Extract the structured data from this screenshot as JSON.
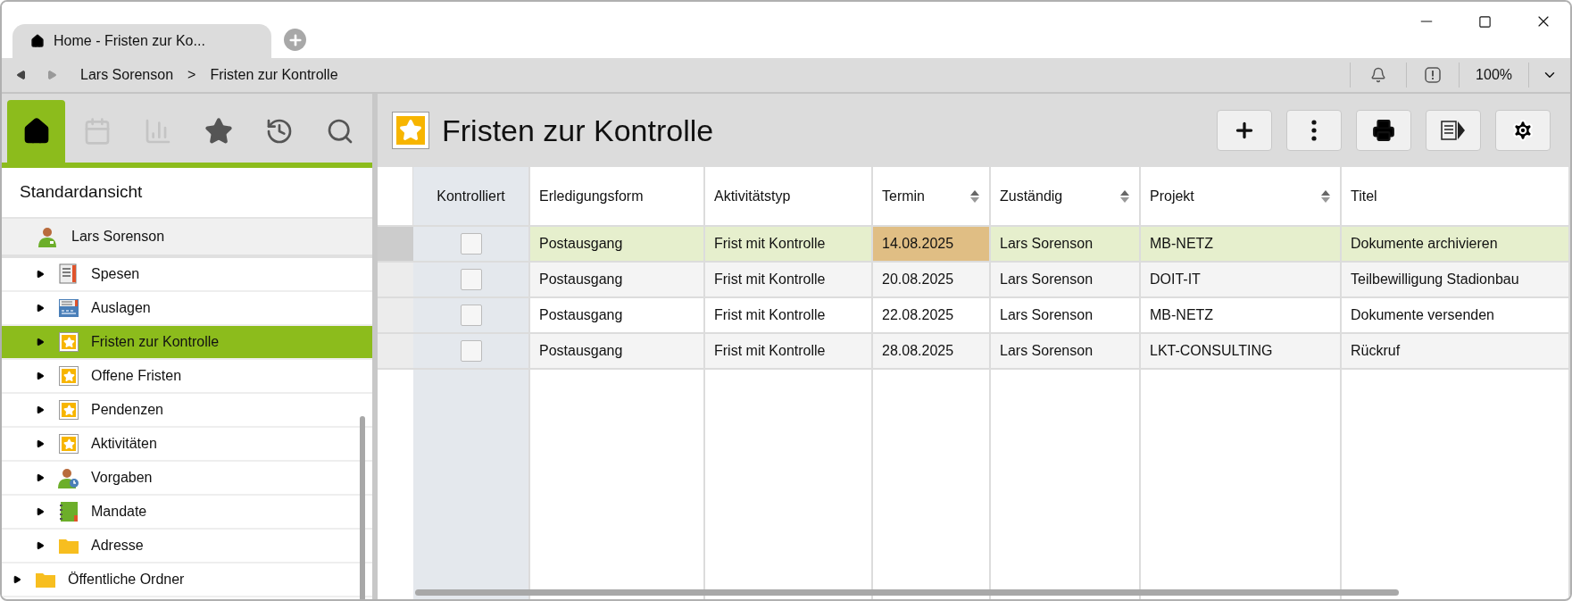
{
  "window": {
    "tab_title": "Home - Fristen zur Ko..."
  },
  "address_bar": {
    "breadcrumbs": [
      "Lars Sorenson",
      ">",
      "Fristen zur Kontrolle"
    ],
    "zoom": "100%"
  },
  "nav_tabs": [
    {
      "kind": "home",
      "selected": true,
      "disabled": false
    },
    {
      "kind": "calendar",
      "selected": false,
      "disabled": true
    },
    {
      "kind": "chart",
      "selected": false,
      "disabled": true
    },
    {
      "kind": "star",
      "selected": false,
      "disabled": false
    },
    {
      "kind": "history",
      "selected": false,
      "disabled": false
    },
    {
      "kind": "search",
      "selected": false,
      "disabled": false
    }
  ],
  "sidebar": {
    "view_title": "Standardansicht",
    "tree": [
      {
        "label": "Lars Sorenson",
        "kind": "person",
        "children": [
          {
            "label": "Spesen",
            "kind": "receipt",
            "expanded": false,
            "selected": false
          },
          {
            "label": "Auslagen",
            "kind": "form",
            "expanded": false,
            "selected": false
          },
          {
            "label": "Fristen zur Kontrolle",
            "kind": "star",
            "expanded": false,
            "selected": true
          },
          {
            "label": "Offene Fristen",
            "kind": "star",
            "expanded": false,
            "selected": false
          },
          {
            "label": "Pendenzen",
            "kind": "star",
            "expanded": false,
            "selected": false
          },
          {
            "label": "Aktivitäten",
            "kind": "star",
            "expanded": false,
            "selected": false
          },
          {
            "label": "Vorgaben",
            "kind": "person-clock",
            "expanded": false,
            "selected": false
          },
          {
            "label": "Mandate",
            "kind": "notebook",
            "expanded": false,
            "selected": false
          },
          {
            "label": "Adresse",
            "kind": "folder",
            "expanded": false,
            "selected": false
          }
        ]
      },
      {
        "label": "Öffentliche Ordner",
        "kind": "folder",
        "expanded": false,
        "selected": false
      }
    ]
  },
  "main": {
    "title": "Fristen zur Kontrolle",
    "toolbar": [
      {
        "kind": "add"
      },
      {
        "kind": "more"
      },
      {
        "kind": "print"
      },
      {
        "kind": "panel"
      },
      {
        "kind": "settings"
      }
    ],
    "table": {
      "columns": [
        {
          "label": "Kontrolliert",
          "sortable": false
        },
        {
          "label": "Erledigungsform",
          "sortable": false
        },
        {
          "label": "Aktivitätstyp",
          "sortable": false
        },
        {
          "label": "Termin",
          "sortable": true
        },
        {
          "label": "Zuständig",
          "sortable": true
        },
        {
          "label": "Projekt",
          "sortable": true
        },
        {
          "label": "Titel",
          "sortable": false
        }
      ],
      "rows": [
        {
          "selected": true,
          "checked": false,
          "termin_highlighted": true,
          "cells": [
            "",
            "Postausgang",
            "Frist mit Kontrolle",
            "14.08.2025",
            "Lars Sorenson",
            "MB-NETZ",
            "Dokumente archivieren"
          ]
        },
        {
          "selected": false,
          "checked": false,
          "termin_highlighted": false,
          "cells": [
            "",
            "Postausgang",
            "Frist mit Kontrolle",
            "20.08.2025",
            "Lars Sorenson",
            "DOIT-IT",
            "Teilbewilligung Stadionbau"
          ]
        },
        {
          "selected": false,
          "checked": false,
          "termin_highlighted": false,
          "cells": [
            "",
            "Postausgang",
            "Frist mit Kontrolle",
            "22.08.2025",
            "Lars Sorenson",
            "MB-NETZ",
            "Dokumente versenden"
          ]
        },
        {
          "selected": false,
          "checked": false,
          "termin_highlighted": false,
          "cells": [
            "",
            "Postausgang",
            "Frist mit Kontrolle",
            "28.08.2025",
            "Lars Sorenson",
            "LKT-CONSULTING",
            "Rückruf"
          ]
        }
      ]
    }
  }
}
